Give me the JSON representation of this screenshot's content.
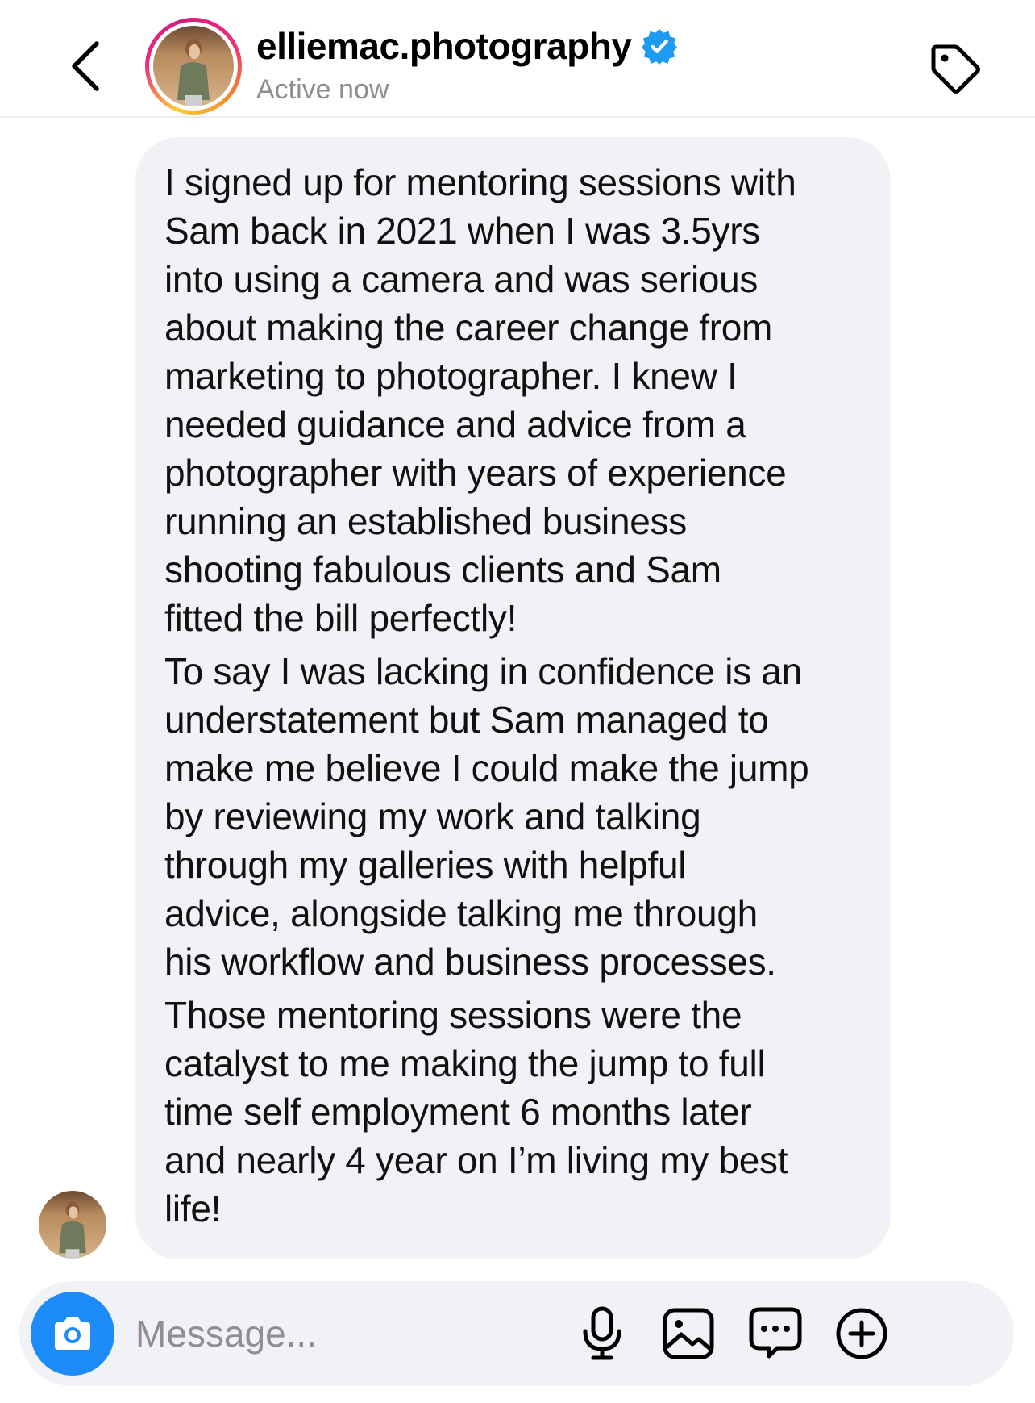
{
  "header": {
    "username": "elliemac.photography",
    "status": "Active now",
    "icons": {
      "back": "chevron-left-icon",
      "verified": "verified-badge-icon",
      "tag": "tag-icon"
    },
    "colors": {
      "verified": "#1d9bf0",
      "status": "#8e8e8e"
    }
  },
  "message": {
    "paragraphs": [
      "I signed up for mentoring sessions with\nSam back in 2021 when I was 3.5yrs\ninto using a camera and was serious\nabout making the career change from\nmarketing to photographer. I knew I\nneeded guidance and advice from a\nphotographer with years of experience\nrunning an established business\nshooting fabulous clients and Sam\nfitted the bill perfectly!",
      "To say I was lacking in confidence is an\nunderstatement but Sam managed to\nmake me believe I could make the jump\nby reviewing my work and talking\nthrough my galleries with helpful\nadvice, alongside talking me through\nhis workflow and business processes.",
      "Those mentoring sessions were the\ncatalyst to me making the jump to full\ntime self employment 6 months later\nand nearly 4 year on I’m living my best\nlife!"
    ],
    "bubble_color": "#f1f2f6"
  },
  "composer": {
    "placeholder": "Message...",
    "value": "",
    "camera_color": "#1d8cf8",
    "icons": [
      "camera-icon",
      "microphone-icon",
      "gallery-icon",
      "sticker-chat-icon",
      "plus-circle-icon"
    ]
  }
}
